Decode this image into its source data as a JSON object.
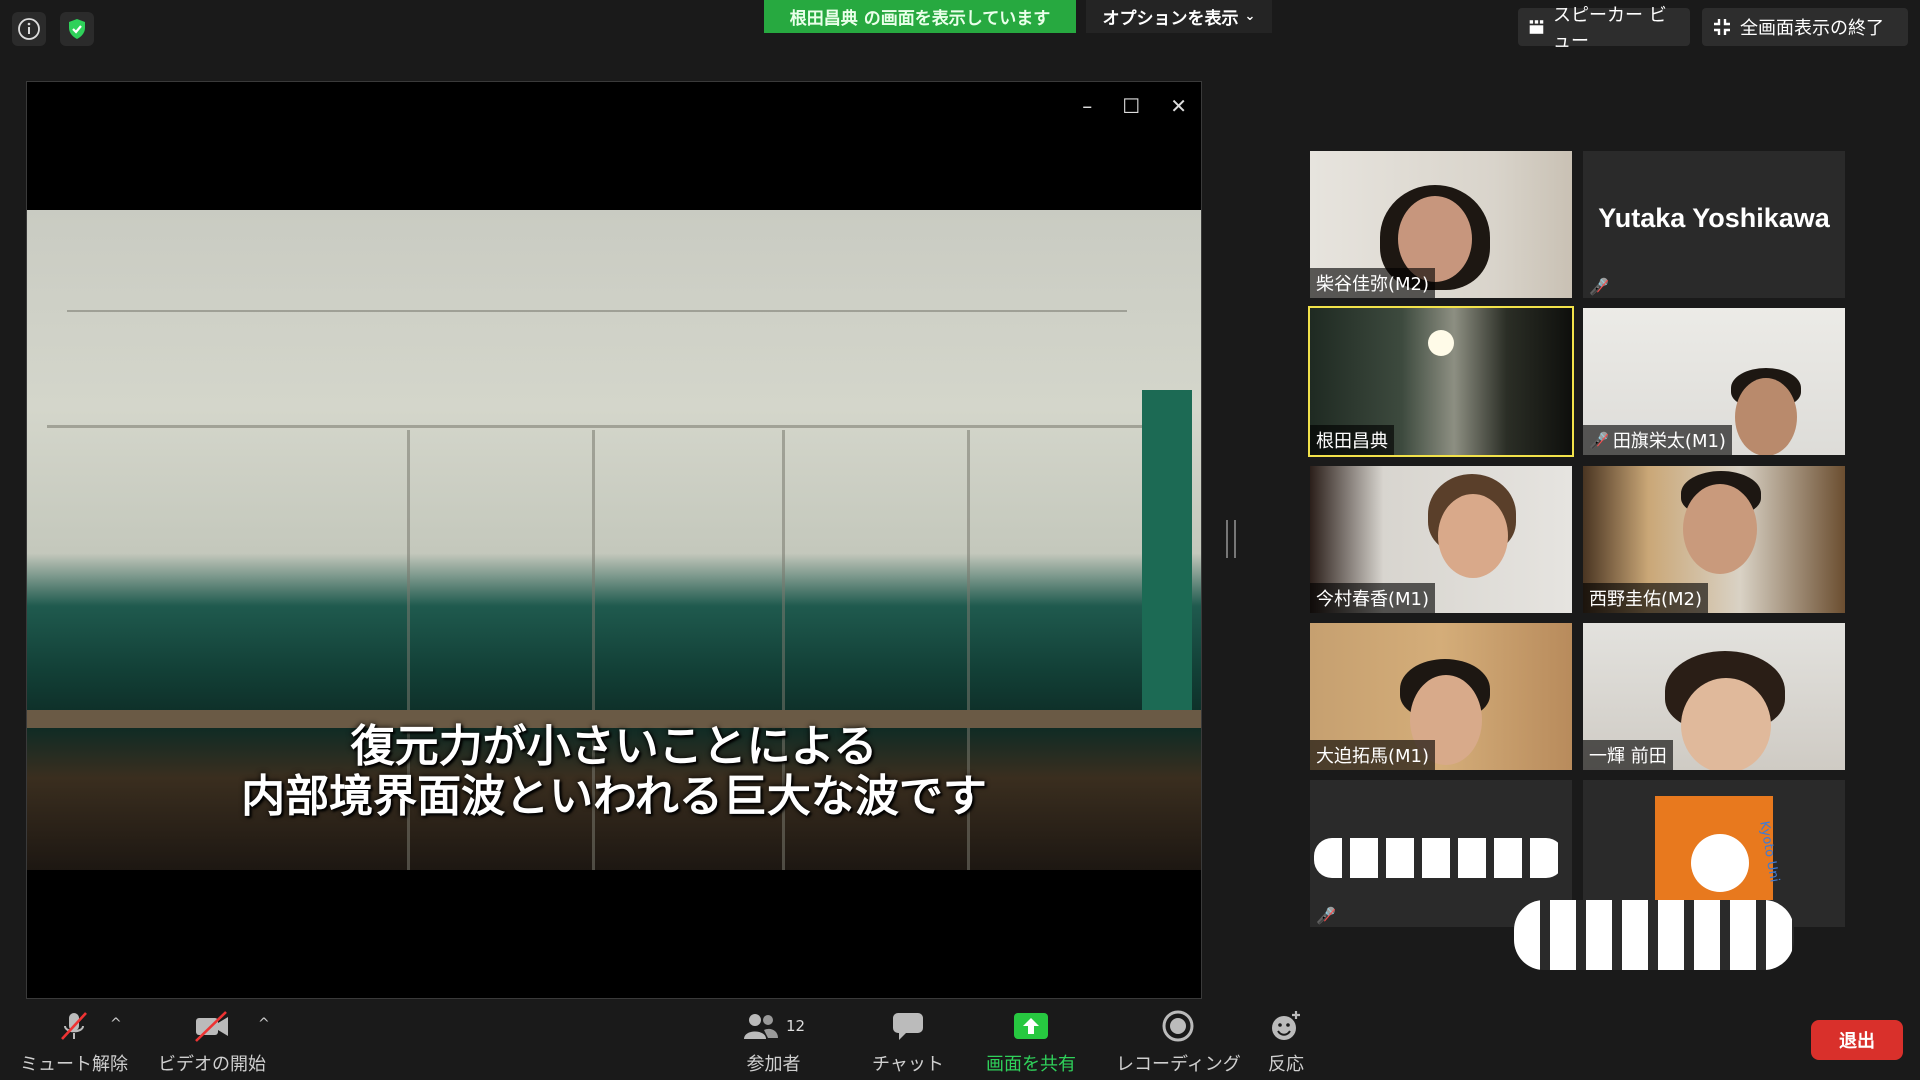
{
  "topbar": {
    "share_banner": "根田昌典 の画面を表示しています",
    "options_label": "オプションを表示",
    "speaker_view": "スピーカー ビュー",
    "exit_fullscreen": "全画面表示の終了"
  },
  "shared_screen": {
    "caption_line1": "復元力が小さいことによる",
    "caption_line2": "内部境界面波といわれる巨大な波です"
  },
  "gallery": {
    "tile1_name": "柴谷佳弥(M2)",
    "tile2_name": "Yutaka Yoshikawa",
    "tile3_name": "根田昌典",
    "tile4_name": "田旗栄太(M1)",
    "tile5_name": "今村春香(M1)",
    "tile6_name": "西野圭佑(M2)",
    "tile7_name": "大迫拓馬(M1)",
    "tile8_name": "一輝 前田",
    "tile10_logo_text": "Kyoto Uni"
  },
  "toolbar": {
    "unmute": "ミュート解除",
    "start_video": "ビデオの開始",
    "participants": "参加者",
    "participants_count": "12",
    "chat": "チャット",
    "share_screen": "画面を共有",
    "recording": "レコーディング",
    "reactions": "反応",
    "leave": "退出"
  },
  "colors": {
    "banner_green": "#27a940",
    "active_speaker": "#f2e24a",
    "leave_red": "#d9302b",
    "share_icon_green": "#27c840"
  }
}
